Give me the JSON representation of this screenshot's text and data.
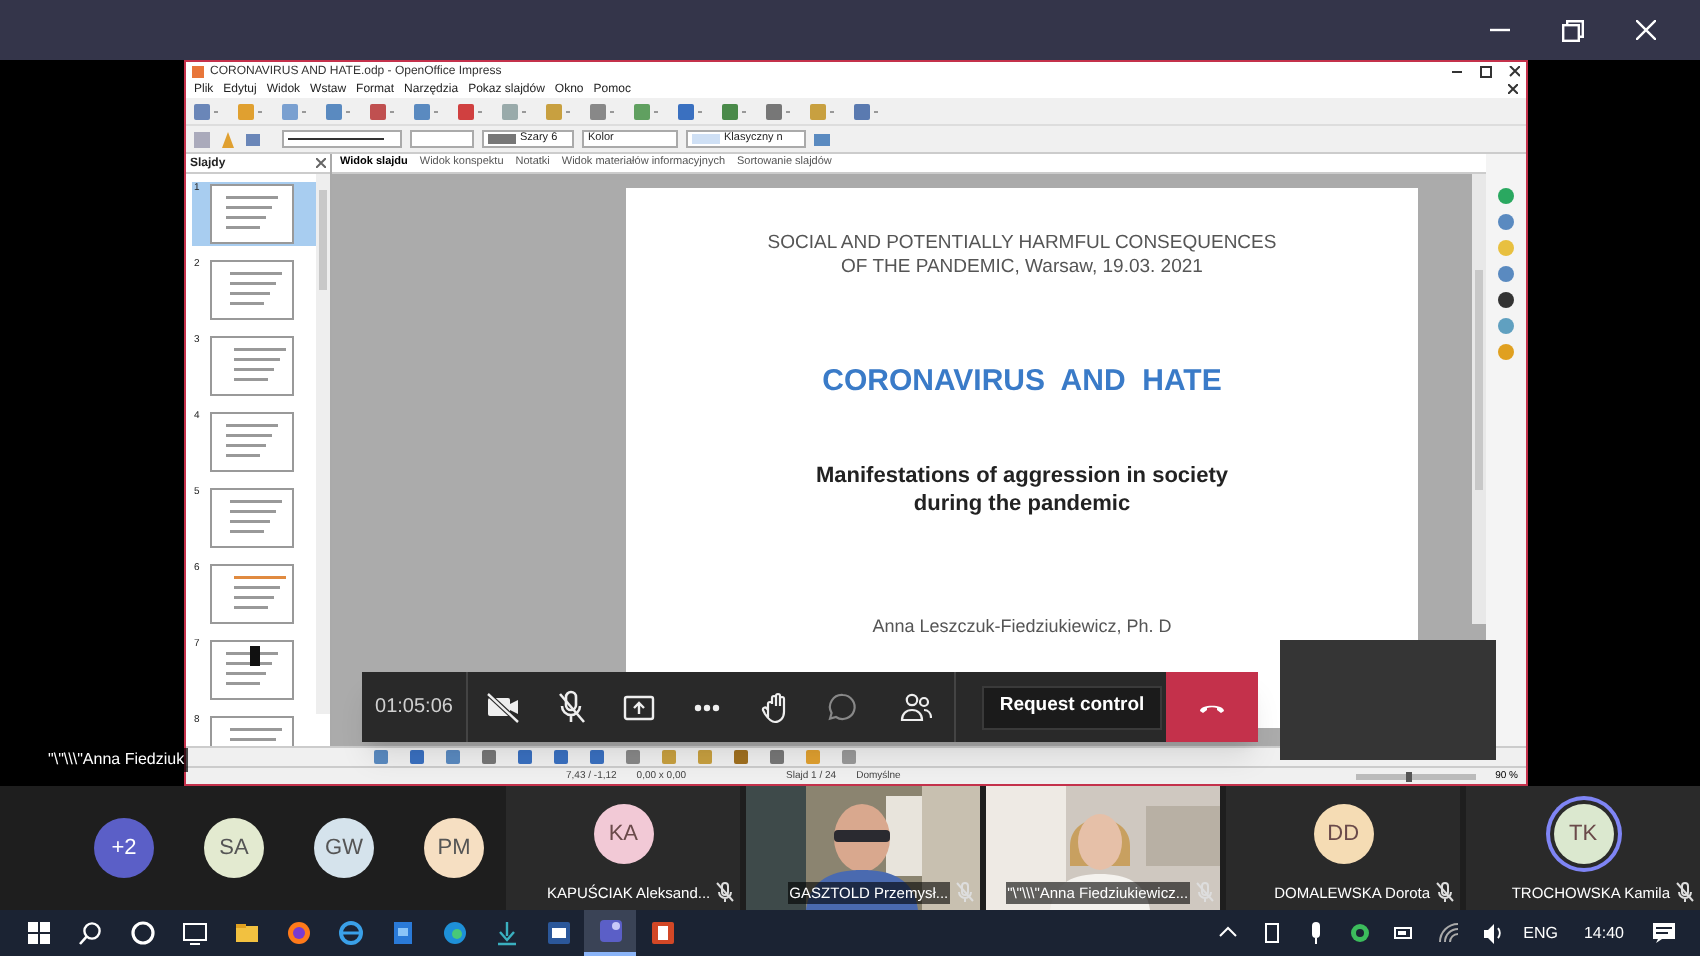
{
  "shared_window": {
    "title": "CORONAVIRUS AND HATE.odp - OpenOffice Impress",
    "menu": [
      "Plik",
      "Edytuj",
      "Widok",
      "Wstaw",
      "Format",
      "Narzędzia",
      "Pokaz slajdów",
      "Okno",
      "Pomoc"
    ],
    "toolbar_fields": [
      "Szary 6",
      "Kolor",
      "Klasyczny n"
    ],
    "slides_panel": {
      "title": "Slajdy",
      "slides": [
        {
          "number": "1",
          "selected": true
        },
        {
          "number": "2",
          "selected": false
        },
        {
          "number": "3",
          "selected": false
        },
        {
          "number": "4",
          "selected": false
        },
        {
          "number": "5",
          "selected": false
        },
        {
          "number": "6",
          "selected": false
        },
        {
          "number": "7",
          "selected": false
        },
        {
          "number": "8",
          "selected": false
        }
      ]
    },
    "view_tabs": [
      {
        "label": "Widok slajdu",
        "selected": true
      },
      {
        "label": "Widok konspektu",
        "selected": false
      },
      {
        "label": "Notatki",
        "selected": false
      },
      {
        "label": "Widok materiałów informacyjnych",
        "selected": false
      },
      {
        "label": "Sortowanie slajdów",
        "selected": false
      }
    ],
    "slide": {
      "header_lines": [
        "SOCIAL AND POTENTIALLY HARMFUL CONSEQUENCES",
        "OF THE PANDEMIC, Warsaw, 19.03. 2021"
      ],
      "title": "CORONAVIRUS  AND  HATE",
      "subtitle_lines": [
        "Manifestations of aggression in society",
        "during the pandemic"
      ],
      "author": "Anna Leszczuk-Fiedziukiewicz, Ph. D"
    },
    "status_bar": {
      "position": "7,43 / -1,12",
      "size": "0,00 x 0,00",
      "slide": "Slajd 1 / 24",
      "layout": "Domyślne",
      "zoom_slider": {
        "level": 0.45
      },
      "zoom": "90 %"
    }
  },
  "presenter_label": "\"\\\"\\\\\\\"Anna Fiedziuk",
  "call_controls": {
    "timer": "01:05:06",
    "camera_on": false,
    "mic_on": false,
    "request_control": "Request control"
  },
  "participants": [
    {
      "kind": "avatar",
      "initials": "+2",
      "color": "#5b5fc7"
    },
    {
      "kind": "avatar",
      "initials": "SA",
      "color": "#e3ead0"
    },
    {
      "kind": "avatar",
      "initials": "GW",
      "color": "#d5e3ec"
    },
    {
      "kind": "avatar",
      "initials": "PM",
      "color": "#f6dfc2"
    },
    {
      "kind": "tile",
      "initials": "KA",
      "color": "#f2c9d6",
      "name": "KAPUŚCIAK Aleksand...",
      "muted": true,
      "speaking": false
    },
    {
      "kind": "video",
      "name": "GASZTOLD Przemysł...",
      "muted": true
    },
    {
      "kind": "video",
      "name": "\"\\\"\\\\\\\"Anna Fiedziukiewicz...",
      "muted": true
    },
    {
      "kind": "tile",
      "initials": "DD",
      "color": "#f5dcb4",
      "name": "DOMALEWSKA Dorota",
      "muted": true,
      "speaking": false
    },
    {
      "kind": "tile",
      "initials": "TK",
      "color": "#dbe8cf",
      "name": "TROCHOWSKA Kamila",
      "muted": true,
      "speaking": true
    }
  ],
  "taskbar": {
    "language": "ENG",
    "time": "14:40"
  }
}
